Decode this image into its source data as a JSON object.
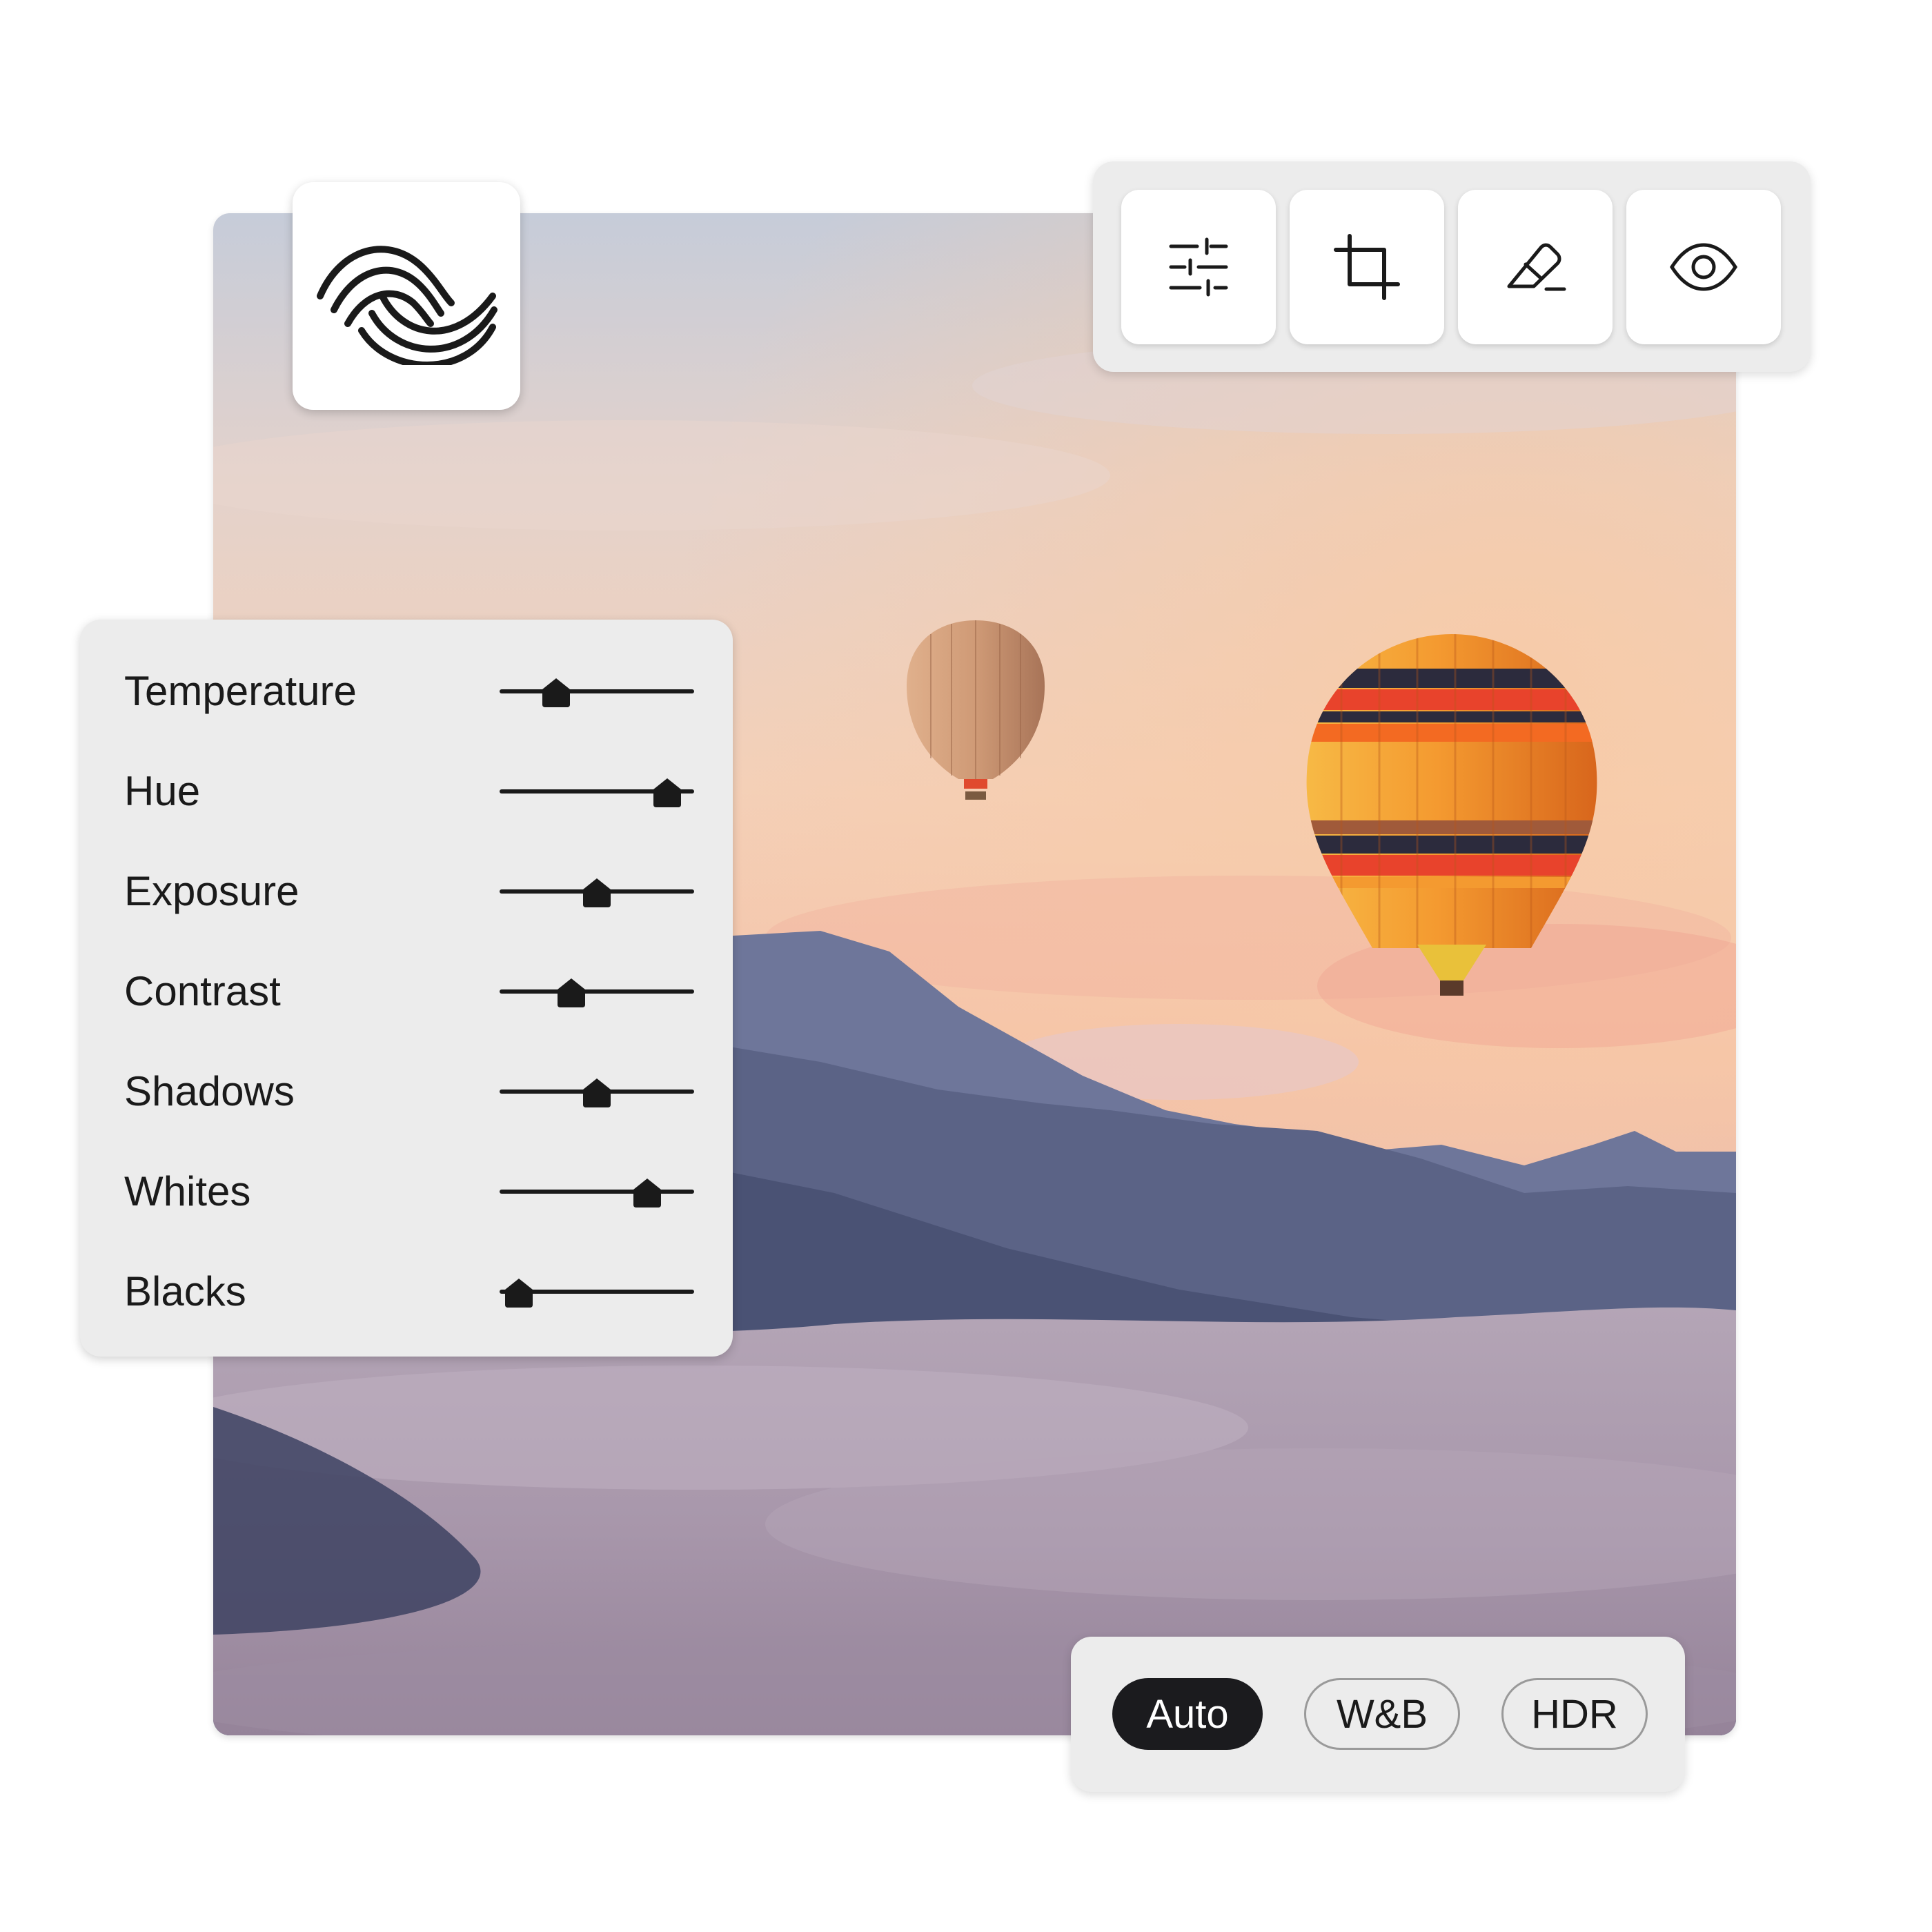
{
  "logo": {
    "icon": "wave-lines-logo"
  },
  "toolbar": {
    "tools": [
      {
        "name": "adjust",
        "icon": "sliders-icon"
      },
      {
        "name": "crop",
        "icon": "crop-icon"
      },
      {
        "name": "erase",
        "icon": "eraser-icon"
      },
      {
        "name": "preview",
        "icon": "eye-icon"
      }
    ]
  },
  "adjustments": [
    {
      "label": "Temperature",
      "value": 0.29
    },
    {
      "label": "Hue",
      "value": 0.86
    },
    {
      "label": "Exposure",
      "value": 0.5
    },
    {
      "label": "Contrast",
      "value": 0.37
    },
    {
      "label": "Shadows",
      "value": 0.5
    },
    {
      "label": "Whites",
      "value": 0.76
    },
    {
      "label": "Blacks",
      "value": 0.1
    }
  ],
  "presets": [
    {
      "label": "Auto",
      "active": true
    },
    {
      "label": "W&B",
      "active": false
    },
    {
      "label": "HDR",
      "active": false
    }
  ],
  "colors": {
    "accent": "#1b1b1e",
    "panel": "#ececec",
    "sky_top": "#c9cedb",
    "sky_warm": "#f6cdb3",
    "mountain": "#4f587c",
    "fog": "#a898ac",
    "balloon_orange": "#f08a28",
    "balloon_red": "#e8432c"
  }
}
